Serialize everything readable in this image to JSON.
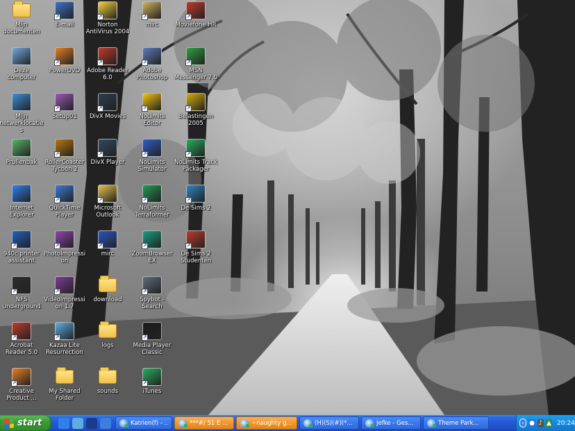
{
  "desktop": {
    "icons": [
      {
        "label": "Mijn documenten",
        "icon": "my-documents-icon",
        "color": "#f2c94c",
        "shortcut": false
      },
      {
        "label": "E-mail",
        "icon": "email-icon",
        "color": "#3b73c8",
        "shortcut": true
      },
      {
        "label": "Norton AntiVirus 2004",
        "icon": "norton-antivirus-icon",
        "color": "#f4d03f",
        "shortcut": true
      },
      {
        "label": "mirc",
        "icon": "mirc-icon",
        "color": "#d0b060",
        "shortcut": true
      },
      {
        "label": "Moviefone HR",
        "icon": "moviefone-icon",
        "color": "#c0392b",
        "shortcut": true
      },
      {
        "label": "Deze computer",
        "icon": "my-computer-icon",
        "color": "#6fa8dc",
        "shortcut": false
      },
      {
        "label": "PowerDVD",
        "icon": "powerdvd-icon",
        "color": "#e67e22",
        "shortcut": true
      },
      {
        "label": "Adobe Reader 6.0",
        "icon": "adobe-reader-icon",
        "color": "#c0392b",
        "shortcut": true
      },
      {
        "label": "Adobe Photoshop",
        "icon": "adobe-photoshop-icon",
        "color": "#5b7db8",
        "shortcut": true
      },
      {
        "label": "MSN Messenger 7.0",
        "icon": "msn-messenger-icon",
        "color": "#2ea043",
        "shortcut": true
      },
      {
        "label": "Mijn netwerklocaties",
        "icon": "network-places-icon",
        "color": "#3a8fd6",
        "shortcut": false
      },
      {
        "label": "Setup01",
        "icon": "setup-icon",
        "color": "#9b59b6",
        "shortcut": true
      },
      {
        "label": "DivX Movies",
        "icon": "divx-movies-icon",
        "color": "#2c3e50",
        "shortcut": true
      },
      {
        "label": "NoLimits Editor",
        "icon": "nolimits-editor-icon",
        "color": "#f1c40f",
        "shortcut": true
      },
      {
        "label": "Belastingen 2005",
        "icon": "belastingen-icon",
        "color": "#d4ac0d",
        "shortcut": true
      },
      {
        "label": "Prullenbak",
        "icon": "recycle-bin-icon",
        "color": "#58b368",
        "shortcut": false
      },
      {
        "label": "RollerCoaster Tycoon 2",
        "icon": "rollercoaster-tycoon-icon",
        "color": "#b9770e",
        "shortcut": true
      },
      {
        "label": "DivX Player",
        "icon": "divx-player-icon",
        "color": "#34495e",
        "shortcut": true
      },
      {
        "label": "NoLimits Simulator",
        "icon": "nolimits-simulator-icon",
        "color": "#2e5cc9",
        "shortcut": true
      },
      {
        "label": "NoLimits Track Packager",
        "icon": "nolimits-track-packager-icon",
        "color": "#27ae60",
        "shortcut": true
      },
      {
        "label": "Internet Explorer",
        "icon": "internet-explorer-icon",
        "color": "#2f80ed",
        "shortcut": false
      },
      {
        "label": "QuickTime Player",
        "icon": "quicktime-icon",
        "color": "#3a7bd5",
        "shortcut": true
      },
      {
        "label": "Microsoft Outlook",
        "icon": "outlook-icon",
        "color": "#e5c04a",
        "shortcut": true
      },
      {
        "label": "NoLimits Terraformer",
        "icon": "nolimits-terraformer-icon",
        "color": "#229954",
        "shortcut": true
      },
      {
        "label": "De Sims 2",
        "icon": "de-sims-2-icon",
        "color": "#2e86c1",
        "shortcut": true
      },
      {
        "label": "940c printer assistant",
        "icon": "hp-printer-icon",
        "color": "#1f5fbf",
        "shortcut": true
      },
      {
        "label": "PhotoImpression",
        "icon": "photoimpression-icon",
        "color": "#8e44ad",
        "shortcut": true
      },
      {
        "label": "mirc",
        "icon": "mirc-icon",
        "color": "#2855c8",
        "shortcut": true
      },
      {
        "label": "ZoomBrowser EX",
        "icon": "zoombrowser-icon",
        "color": "#16a085",
        "shortcut": true
      },
      {
        "label": "De Sims 2 Studenten",
        "icon": "de-sims-2-studenten-icon",
        "color": "#c0392b",
        "shortcut": true
      },
      {
        "label": "NFS Underground",
        "icon": "nfs-underground-icon",
        "color": "#2c2c2c",
        "shortcut": true
      },
      {
        "label": "VideoImpression 1.7",
        "icon": "videoimpression-icon",
        "color": "#7d3c98",
        "shortcut": true
      },
      {
        "label": "download",
        "icon": "folder-icon",
        "color": "#f2c94c",
        "shortcut": false
      },
      {
        "label": "Spybot - Search",
        "icon": "spybot-icon",
        "color": "#5d6d7e",
        "shortcut": true
      },
      {
        "label": "",
        "icon": "",
        "color": "",
        "shortcut": false
      },
      {
        "label": "Acrobat Reader 5.0",
        "icon": "acrobat-reader-icon",
        "color": "#c0392b",
        "shortcut": true
      },
      {
        "label": "Kazaa Lite Resurrection",
        "icon": "kazaa-lite-icon",
        "color": "#5dade2",
        "shortcut": true
      },
      {
        "label": "logs",
        "icon": "folder-icon",
        "color": "#f2c94c",
        "shortcut": false
      },
      {
        "label": "Media Player Classic",
        "icon": "media-player-classic-icon",
        "color": "#1c1c1c",
        "shortcut": true
      },
      {
        "label": "",
        "icon": "",
        "color": "",
        "shortcut": false
      },
      {
        "label": "Creative Product ...",
        "icon": "creative-product-icon",
        "color": "#e67e22",
        "shortcut": true
      },
      {
        "label": "My Shared Folder",
        "icon": "shared-folder-icon",
        "color": "#f2c94c",
        "shortcut": false
      },
      {
        "label": "sounds",
        "icon": "folder-icon",
        "color": "#f2c94c",
        "shortcut": false
      },
      {
        "label": "iTunes",
        "icon": "itunes-icon",
        "color": "#27ae60",
        "shortcut": true
      },
      {
        "label": "",
        "icon": "",
        "color": "",
        "shortcut": false
      }
    ]
  },
  "taskbar": {
    "start_label": "start",
    "quick_launch": [
      {
        "icon": "internet-explorer-icon",
        "color": "#2f80ed"
      },
      {
        "icon": "show-desktop-icon",
        "color": "#5dade2"
      },
      {
        "icon": "media-player-icon",
        "color": "#1b3b8a"
      },
      {
        "icon": "msn-messenger-icon",
        "color": "#3b7fe0"
      }
    ],
    "tasks": [
      {
        "label": "Katrien(f) - ...",
        "flash": false
      },
      {
        "label": "***#/ 51 E ...",
        "flash": true
      },
      {
        "label": "~naughty g...",
        "flash": true
      },
      {
        "label": "(H)(S)(#)(*...",
        "flash": false
      },
      {
        "label": "Jefke - Ges...",
        "flash": false
      },
      {
        "label": "Theme Park...",
        "flash": false
      }
    ],
    "tray": {
      "time": "20:24"
    }
  },
  "colors": {
    "taskbar_blue": "#2458d2",
    "start_green": "#3c9d36",
    "tray_blue": "#1587e0",
    "task_flash_orange": "#f0962a"
  }
}
